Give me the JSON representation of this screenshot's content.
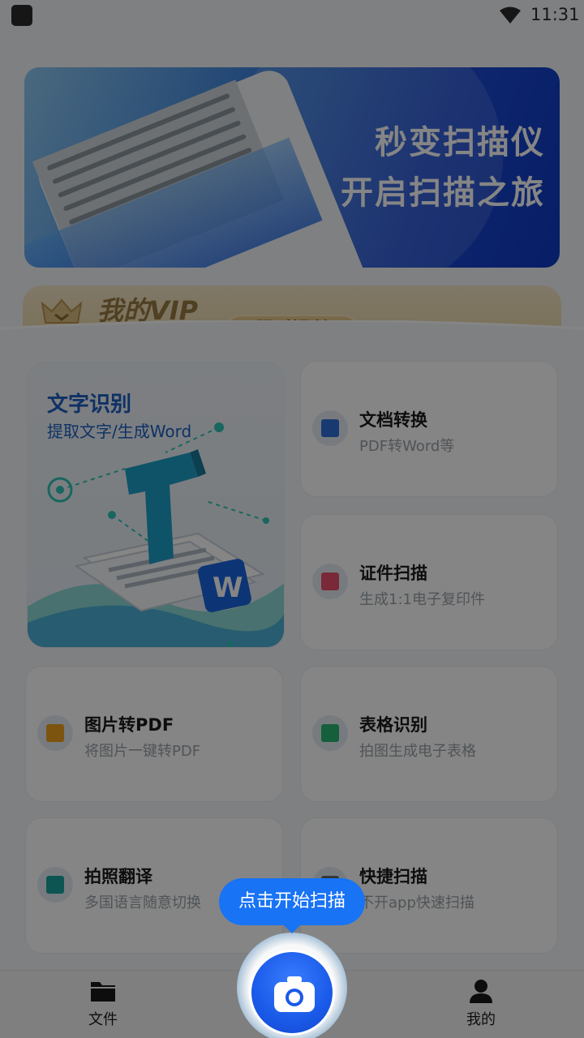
{
  "status_bar": {
    "time": "11:31"
  },
  "banner": {
    "line1": "秒变扫描仪",
    "line2": "开启扫描之旅"
  },
  "vip": {
    "title": "我的VIP",
    "badge": "限时福利"
  },
  "ocr_card": {
    "title": "文字识别",
    "subtitle": "提取文字/生成Word"
  },
  "features": [
    {
      "title": "文档转换",
      "subtitle": "PDF转Word等",
      "icon": "word-doc-icon",
      "color": "#2e6fd8"
    },
    {
      "title": "证件扫描",
      "subtitle": "生成1:1电子复印件",
      "icon": "id-card-icon",
      "color": "#e8506a"
    },
    {
      "title": "图片转PDF",
      "subtitle": "将图片一键转PDF",
      "icon": "pdf-icon",
      "color": "#f0a020"
    },
    {
      "title": "表格识别",
      "subtitle": "拍图生成电子表格",
      "icon": "table-icon",
      "color": "#2bb673"
    },
    {
      "title": "拍照翻译",
      "subtitle": "多国语言随意切换",
      "icon": "translate-icon",
      "color": "#1aa3a0"
    },
    {
      "title": "快捷扫描",
      "subtitle": "不开app快速扫描",
      "icon": "quick-scan-icon",
      "color": "#6a6a6a"
    }
  ],
  "tooltip": {
    "text": "点击开始扫描"
  },
  "bottom_nav": {
    "files_label": "文件",
    "me_label": "我的"
  },
  "colors": {
    "accent": "#1873f5",
    "overlay": "rgba(0,0,0,0.48)"
  }
}
